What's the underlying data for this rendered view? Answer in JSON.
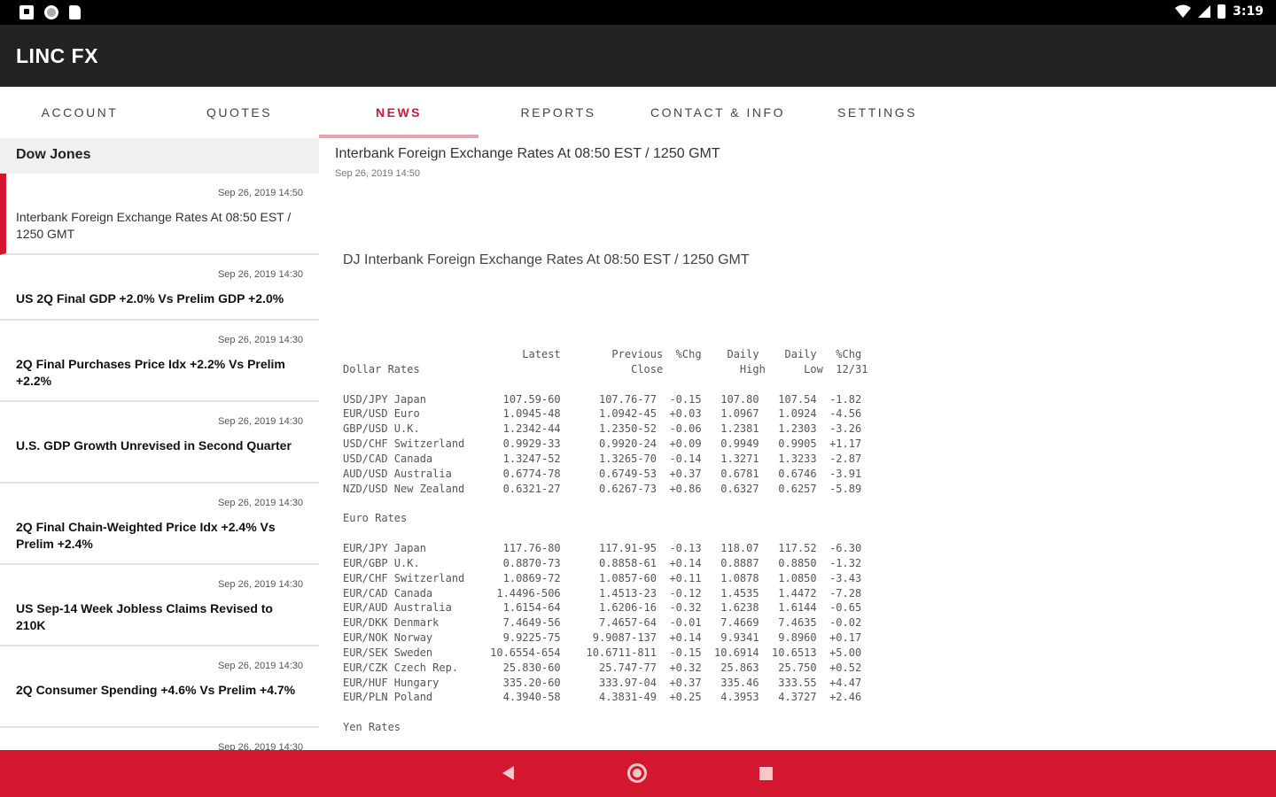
{
  "status_bar": {
    "time": "3:19",
    "icons": [
      "screenshot-icon",
      "circle-icon",
      "file-icon",
      "wifi-icon",
      "signal-icon",
      "battery-icon"
    ]
  },
  "app": {
    "title": "LINC FX"
  },
  "tabs": [
    {
      "label": "ACCOUNT"
    },
    {
      "label": "QUOTES"
    },
    {
      "label": "NEWS",
      "active": true
    },
    {
      "label": "REPORTS"
    },
    {
      "label": "CONTACT & INFO"
    },
    {
      "label": "SETTINGS"
    }
  ],
  "sidebar": {
    "source": "Dow Jones",
    "items": [
      {
        "date": "Sep 26, 2019 14:50",
        "title": "Interbank Foreign Exchange Rates At 08:50 EST / 1250 GMT"
      },
      {
        "date": "Sep 26, 2019 14:30",
        "title": "US 2Q Final GDP +2.0% Vs Prelim GDP +2.0%"
      },
      {
        "date": "Sep 26, 2019 14:30",
        "title": "2Q Final Purchases Price Idx +2.2% Vs Prelim +2.2%"
      },
      {
        "date": "Sep 26, 2019 14:30",
        "title": "U.S. GDP Growth Unrevised in Second Quarter"
      },
      {
        "date": "Sep 26, 2019 14:30",
        "title": "2Q Final Chain-Weighted Price Idx +2.4% Vs Prelim +2.4%"
      },
      {
        "date": "Sep 26, 2019 14:30",
        "title": "US Sep-14 Week Jobless Claims Revised to 210K"
      },
      {
        "date": "Sep 26, 2019 14:30",
        "title": "2Q Consumer Spending +4.6% Vs Prelim +4.7%"
      },
      {
        "date": "Sep 26, 2019 14:30",
        "title": ""
      }
    ]
  },
  "article": {
    "title": "Interbank Foreign Exchange Rates At 08:50 EST / 1250 GMT",
    "date": "Sep 26, 2019 14:50",
    "subtitle": "DJ Interbank Foreign Exchange Rates At 08:50 EST / 1250 GMT",
    "rate_lines": [
      "                            Latest        Previous  %Chg    Daily    Daily   %Chg",
      "Dollar Rates                                 Close            High      Low  12/31",
      "",
      "USD/JPY Japan            107.59-60      107.76-77  -0.15   107.80   107.54  -1.82",
      "EUR/USD Euro             1.0945-48      1.0942-45  +0.03   1.0967   1.0924  -4.56",
      "GBP/USD U.K.             1.2342-44      1.2350-52  -0.06   1.2381   1.2303  -3.26",
      "USD/CHF Switzerland      0.9929-33      0.9920-24  +0.09   0.9949   0.9905  +1.17",
      "USD/CAD Canada           1.3247-52      1.3265-70  -0.14   1.3271   1.3233  -2.87",
      "AUD/USD Australia        0.6774-78      0.6749-53  +0.37   0.6781   0.6746  -3.91",
      "NZD/USD New Zealand      0.6321-27      0.6267-73  +0.86   0.6327   0.6257  -5.89",
      "",
      "Euro Rates",
      "",
      "EUR/JPY Japan            117.76-80      117.91-95  -0.13   118.07   117.52  -6.30",
      "EUR/GBP U.K.             0.8870-73      0.8858-61  +0.14   0.8887   0.8850  -1.32",
      "EUR/CHF Switzerland      1.0869-72      1.0857-60  +0.11   1.0878   1.0850  -3.43",
      "EUR/CAD Canada          1.4496-506      1.4513-23  -0.12   1.4535   1.4472  -7.28",
      "EUR/AUD Australia        1.6154-64      1.6206-16  -0.32   1.6238   1.6144  -0.65",
      "EUR/DKK Denmark          7.4649-56      7.4657-64  -0.01   7.4669   7.4635  -0.02",
      "EUR/NOK Norway           9.9225-75     9.9087-137  +0.14   9.9341   9.8960  +0.17",
      "EUR/SEK Sweden         10.6554-654    10.6711-811  -0.15  10.6914  10.6513  +5.00",
      "EUR/CZK Czech Rep.       25.830-60      25.747-77  +0.32   25.863   25.750  +0.52",
      "EUR/HUF Hungary          335.20-60      333.97-04  +0.37   335.46   333.55  +4.47",
      "EUR/PLN Poland           4.3940-58      4.3831-49  +0.25   4.3953   4.3727  +2.46",
      "",
      "Yen Rates"
    ]
  },
  "nav_bar": {
    "accent": "#d3172e",
    "buttons": [
      "back-icon",
      "home-icon",
      "recent-apps-icon"
    ]
  }
}
